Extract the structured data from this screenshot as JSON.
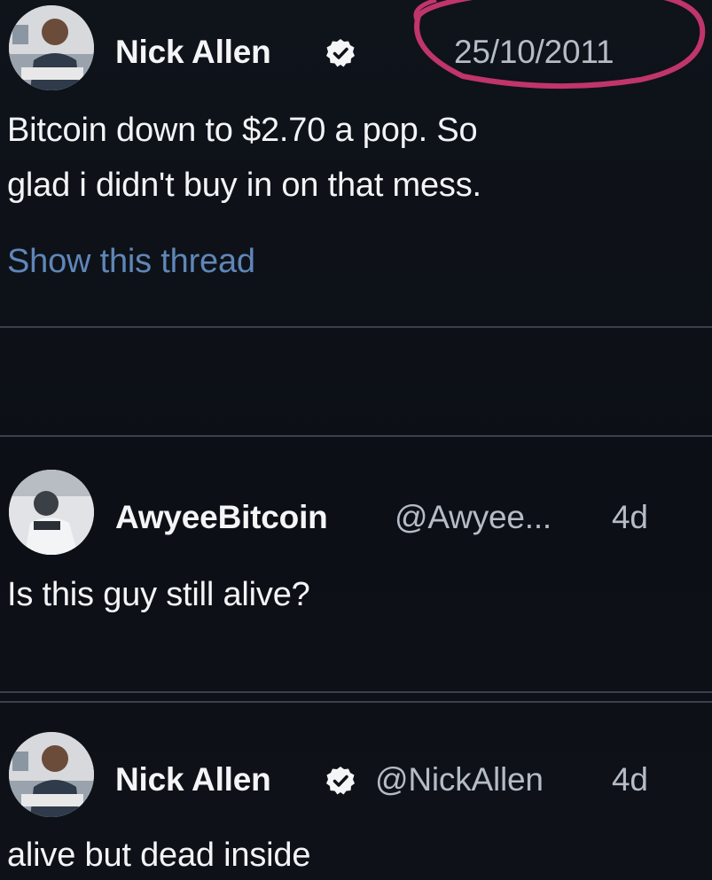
{
  "tweets": [
    {
      "author_name": "Nick Allen",
      "verified_icon": "verified-badge-icon",
      "date": "25/10/2011",
      "text_lines": [
        "Bitcoin down to $2.70 a pop. So",
        "glad i didn't buy in on that mess."
      ],
      "thread_link": "Show this thread"
    },
    {
      "author_name": "AwyeeBitcoin",
      "handle": "@Awyee...",
      "time": "4d",
      "text": "Is this guy still alive?"
    },
    {
      "author_name": "Nick Allen",
      "verified_icon": "verified-badge-icon",
      "handle": "@NickAllen",
      "time": "4d",
      "text": "alive but dead inside"
    }
  ],
  "colors": {
    "background": "#0d1117",
    "link": "#5f86b8",
    "annotation_circle": "#c0356a",
    "muted_text": "#b5bcc6"
  }
}
